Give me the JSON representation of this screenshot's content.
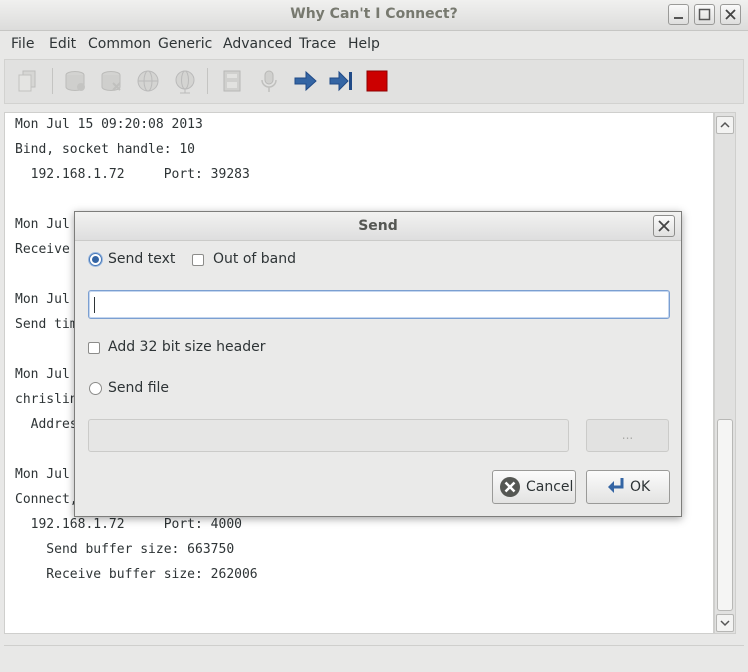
{
  "window": {
    "title": "Why Can't I Connect?"
  },
  "menu": [
    "File",
    "Edit",
    "Common",
    "Generic",
    "Advanced",
    "Trace",
    "Help"
  ],
  "toolbar": {
    "icons": [
      "copy-icon",
      "database-icon",
      "database-icon",
      "globe-icon",
      "globe-icon",
      "disk-icon",
      "microphone-icon",
      "arrow-right-icon",
      "step-forward-icon",
      "stop-icon"
    ]
  },
  "log": [
    {
      "text": "Mon Jul 15 09:20:08 2013"
    },
    {
      "text": "Bind, socket handle: 10"
    },
    {
      "text": "  192.168.1.72     Port: 39283"
    },
    {
      "text": "Mon Jul"
    },
    {
      "text": "Receive"
    },
    {
      "text": "Mon Jul"
    },
    {
      "text": "Send tim"
    },
    {
      "text": "Mon Jul"
    },
    {
      "text": "chrislin"
    },
    {
      "text": "  Addres"
    },
    {
      "text": "Mon Jul"
    },
    {
      "text": "Connect,"
    },
    {
      "text": "  192.168.1.72     Port: 4000"
    },
    {
      "text": "    Send buffer size: 663750"
    },
    {
      "text": "    Receive buffer size: 262006"
    }
  ],
  "dialog": {
    "title": "Send",
    "send_text_label": "Send text",
    "send_text_selected": true,
    "out_of_band_label": "Out of band",
    "out_of_band_checked": false,
    "text_value": "",
    "size_header_label": "Add 32 bit size header",
    "size_header_checked": false,
    "send_file_label": "Send file",
    "send_file_selected": false,
    "file_path_value": "",
    "browse_label": "...",
    "cancel_label": "Cancel",
    "ok_label": "OK"
  },
  "colors": {
    "stop_button": "#cc0000",
    "arrow": "#3465a4"
  }
}
